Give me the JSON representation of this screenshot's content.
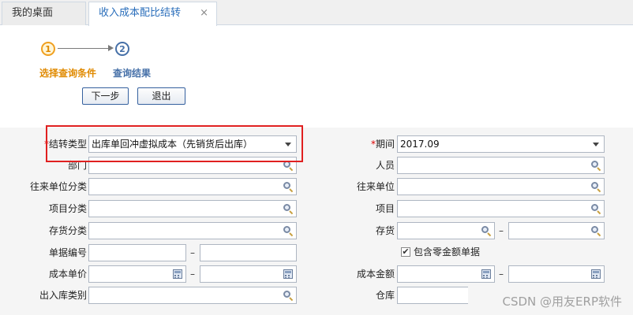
{
  "tabs": [
    {
      "label": "我的桌面"
    },
    {
      "label": "收入成本配比结转",
      "close": "×"
    }
  ],
  "steps": [
    {
      "number": "1",
      "label": "选择查询条件",
      "color": "#e08a00"
    },
    {
      "number": "2",
      "label": "查询结果",
      "color": "#4670a8"
    }
  ],
  "buttons": {
    "next": "下一步",
    "exit": "退出"
  },
  "form": {
    "required_mark": "*",
    "transfer_type": {
      "label": "结转类型",
      "value": "出库单回冲虚拟成本（先销货后出库）"
    },
    "period": {
      "label": "期间",
      "value": "2017.09"
    },
    "department": {
      "label": "部门",
      "value": ""
    },
    "person": {
      "label": "人员",
      "value": ""
    },
    "partner_category": {
      "label": "往来单位分类",
      "value": ""
    },
    "partner": {
      "label": "往来单位",
      "value": ""
    },
    "project_category": {
      "label": "项目分类",
      "value": ""
    },
    "project": {
      "label": "项目",
      "value": ""
    },
    "inventory_category": {
      "label": "存货分类",
      "value": ""
    },
    "inventory": {
      "label": "存货",
      "from": "",
      "to": ""
    },
    "doc_number": {
      "label": "单据编号",
      "from": "",
      "to": ""
    },
    "include_zero": {
      "label": "包含零金额单据",
      "checked": true,
      "mark": "✔"
    },
    "unit_cost": {
      "label": "成本单价",
      "from": "",
      "to": ""
    },
    "cost_amount": {
      "label": "成本金额",
      "from": "",
      "to": ""
    },
    "io_category": {
      "label": "出入库类别",
      "value": ""
    },
    "warehouse": {
      "label": "仓库",
      "value": ""
    },
    "range_sep": "–"
  },
  "watermark": "CSDN @用友ERP软件",
  "colors": {
    "highlight": "#e02020",
    "accent": "#2a6ebb"
  }
}
